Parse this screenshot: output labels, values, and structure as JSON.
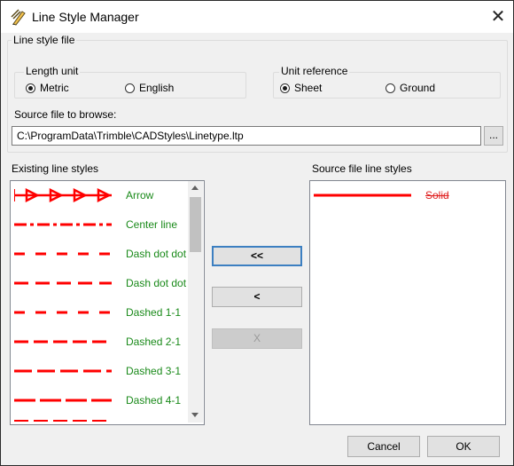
{
  "window": {
    "title": "Line Style Manager"
  },
  "line_style_file": {
    "group_label": "Line style file",
    "length_unit": {
      "label": "Length unit",
      "options": [
        {
          "label": "Metric",
          "selected": true
        },
        {
          "label": "English",
          "selected": false
        }
      ]
    },
    "unit_reference": {
      "label": "Unit reference",
      "options": [
        {
          "label": "Sheet",
          "selected": true
        },
        {
          "label": "Ground",
          "selected": false
        }
      ]
    },
    "source_label": "Source file to browse:",
    "source_value": "C:\\ProgramData\\Trimble\\CADStyles\\Linetype.ltp",
    "browse_label": "..."
  },
  "existing": {
    "label": "Existing line styles",
    "items": [
      {
        "label": "Arrow",
        "pattern": "arrow"
      },
      {
        "label": "Center line",
        "pattern": "center"
      },
      {
        "label": "Dash dot dot",
        "pattern": "dash1"
      },
      {
        "label": "Dash dot dot",
        "pattern": "dash2"
      },
      {
        "label": "Dashed 1-1",
        "pattern": "dashed11"
      },
      {
        "label": "Dashed 2-1",
        "pattern": "dashed21"
      },
      {
        "label": "Dashed 3-1",
        "pattern": "dashed31"
      },
      {
        "label": "Dashed 4-1",
        "pattern": "dashed41"
      }
    ]
  },
  "buttons": {
    "copy_all": "<<",
    "copy": "<",
    "delete": "X",
    "cancel": "Cancel",
    "ok": "OK"
  },
  "source_styles": {
    "label": "Source file line styles",
    "items": [
      {
        "label": "Solid",
        "pattern": "solid"
      }
    ]
  },
  "colors": {
    "line": "#ff0000",
    "existing_text": "#1a8a1a",
    "source_text": "#e02020"
  }
}
